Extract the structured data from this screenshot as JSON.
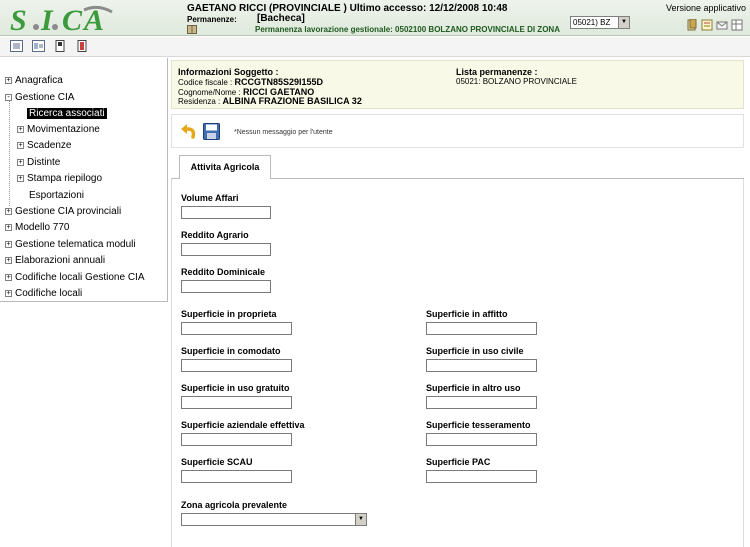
{
  "header": {
    "user_line": "GAETANO RICCI (PROVINCIALE ) Ultimo accesso: 12/12/2008 10:48",
    "permanenze_label": "Permanenze:",
    "permanenze_value": "[Bacheca]",
    "permanenza_lavorazione": "Permanenza lavorazione gestionale: 0502100 BOLZANO PROVINCIALE DI ZONA",
    "office_selected": "05021) BZ",
    "version_label": "Versione applicativo"
  },
  "sidebar": {
    "items": [
      {
        "label": "Anagrafica",
        "expander": "+"
      },
      {
        "label": "Gestione CIA",
        "expander": "-"
      },
      {
        "label": "Ricerca associati"
      },
      {
        "label": "Movimentazione",
        "expander": "+"
      },
      {
        "label": "Scadenze",
        "expander": "+"
      },
      {
        "label": "Distinte",
        "expander": "+"
      },
      {
        "label": "Stampa riepilogo",
        "expander": "+"
      },
      {
        "label": "Esportazioni"
      },
      {
        "label": "Gestione CIA provinciali",
        "expander": "+"
      },
      {
        "label": "Modello 770",
        "expander": "+"
      },
      {
        "label": "Gestione telematica moduli",
        "expander": "+"
      },
      {
        "label": "Elaborazioni annuali",
        "expander": "+"
      },
      {
        "label": "Codifiche locali Gestione CIA",
        "expander": "+"
      },
      {
        "label": "Codifiche locali",
        "expander": "+"
      }
    ]
  },
  "info": {
    "soggetto_title": "Informazioni Soggetto :",
    "codice_fiscale_label": "Codice fiscale :",
    "codice_fiscale": "RCCGTN85S29I155D",
    "cognome_nome_label": "Cognome/Nome :",
    "cognome_nome": "RICCI GAETANO",
    "residenza_label": "Residenza :",
    "residenza": "ALBINA  FRAZIONE BASILICA 32",
    "permanenze_title": "Lista permanenze :",
    "permanenza_item": "05021: BOLZANO PROVINCIALE"
  },
  "actions": {
    "message": "*Nessun messaggio per l'utente"
  },
  "tabs": [
    {
      "label": "Attivita Agricola"
    }
  ],
  "form": {
    "volume_affari": {
      "label": "Volume Affari",
      "value": ""
    },
    "reddito_agrario": {
      "label": "Reddito Agrario",
      "value": ""
    },
    "reddito_dominicale": {
      "label": "Reddito Dominicale",
      "value": ""
    },
    "sup_proprieta": {
      "label": "Superficie in proprieta",
      "value": ""
    },
    "sup_affitto": {
      "label": "Superficie in affitto",
      "value": ""
    },
    "sup_comodato": {
      "label": "Superficie in comodato",
      "value": ""
    },
    "sup_uso_civile": {
      "label": "Superficie in uso civile",
      "value": ""
    },
    "sup_uso_gratuito": {
      "label": "Superficie in uso gratuito",
      "value": ""
    },
    "sup_altro_uso": {
      "label": "Superficie in altro uso",
      "value": ""
    },
    "sup_aziendale": {
      "label": "Superficie aziendale effettiva",
      "value": ""
    },
    "sup_tesseramento": {
      "label": "Superficie tesseramento",
      "value": ""
    },
    "sup_scau": {
      "label": "Superficie SCAU",
      "value": ""
    },
    "sup_pac": {
      "label": "Superficie PAC",
      "value": ""
    },
    "zona_agricola": {
      "label": "Zona agricola prevalente",
      "value": ""
    }
  },
  "colors": {
    "header_bg": "#dfe9dc",
    "logo_green": "#3b9a3b",
    "logo_grey": "#8b8b8b",
    "perm_text": "#1f5a1f",
    "info_bg": "#f9f9e8"
  },
  "icons": [
    "logo-sicia",
    "book-icon",
    "document-icon",
    "notes-icon",
    "mail-icon",
    "grid-icon",
    "list-view-icon",
    "expand-view-icon",
    "document-edit-icon",
    "exit-icon",
    "undo-icon",
    "save-icon",
    "dropdown-arrow-icon"
  ]
}
